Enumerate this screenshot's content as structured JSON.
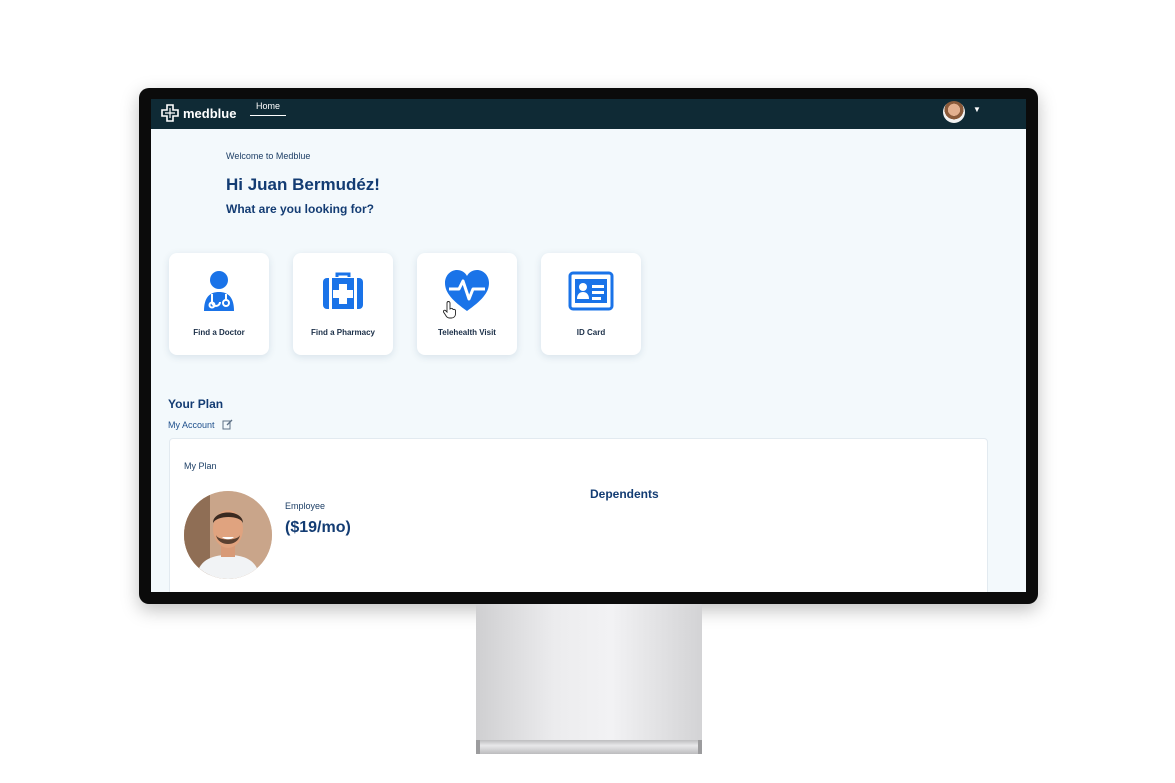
{
  "app": {
    "logo_text": "medblue",
    "nav": {
      "home_label": "Home"
    },
    "colors": {
      "topbar": "#0f2a35",
      "accent": "#1a73e8",
      "heading": "#133c73"
    }
  },
  "welcome": {
    "subtitle": "Welcome to Medblue",
    "greeting": "Hi Juan Bermudéz!",
    "question": "What are you looking for?"
  },
  "tiles": [
    {
      "label": "Find a Doctor",
      "icon": "doctor-icon"
    },
    {
      "label": "Find a Pharmacy",
      "icon": "medical-kit-icon"
    },
    {
      "label": "Telehealth Visit",
      "icon": "heartbeat-icon"
    },
    {
      "label": "ID Card",
      "icon": "id-card-icon"
    }
  ],
  "plan": {
    "title": "Your Plan",
    "account_link": "My Account",
    "card": {
      "my_plan_label": "My Plan",
      "employee_label": "Employee",
      "price": "($19/mo)",
      "dependents_label": "Dependents"
    }
  }
}
